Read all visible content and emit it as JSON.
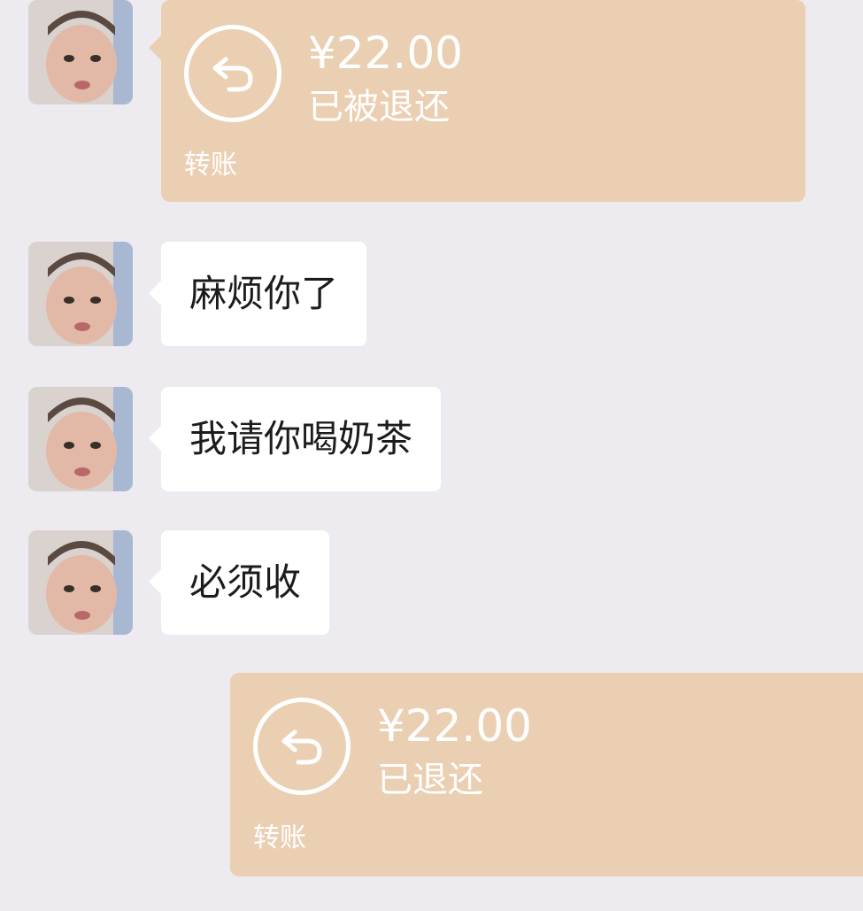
{
  "messages": [
    {
      "type": "transfer",
      "direction": "incoming",
      "amount": "¥22.00",
      "status": "已被退还",
      "footer": "转账"
    },
    {
      "type": "text",
      "direction": "incoming",
      "text": "麻烦你了"
    },
    {
      "type": "text",
      "direction": "incoming",
      "text": "我请你喝奶茶"
    },
    {
      "type": "text",
      "direction": "incoming",
      "text": "必须收"
    },
    {
      "type": "transfer",
      "direction": "outgoing",
      "amount": "¥22.00",
      "status": "已退还",
      "footer": "转账"
    }
  ],
  "colors": {
    "background": "#edebef",
    "transfer_bubble": "#ebcfb3",
    "text_bubble": "#ffffff",
    "text": "#1c1c1c"
  },
  "icons": {
    "return": "return-arrow-icon",
    "avatar": "contact-avatar-photo"
  }
}
